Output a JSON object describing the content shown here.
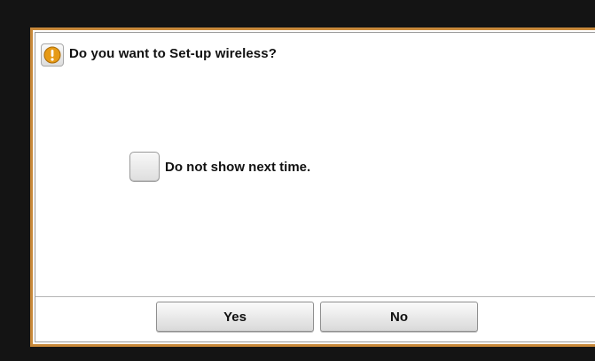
{
  "dialog": {
    "icon": "warning-icon",
    "title": "Do you want to Set-up wireless?",
    "checkbox_label": "Do not show next time.",
    "checkbox_checked": false,
    "yes_label": "Yes",
    "no_label": "No"
  },
  "colors": {
    "frame_border": "#c8893a",
    "background": "#141414",
    "icon_accent": "#e69a16"
  }
}
